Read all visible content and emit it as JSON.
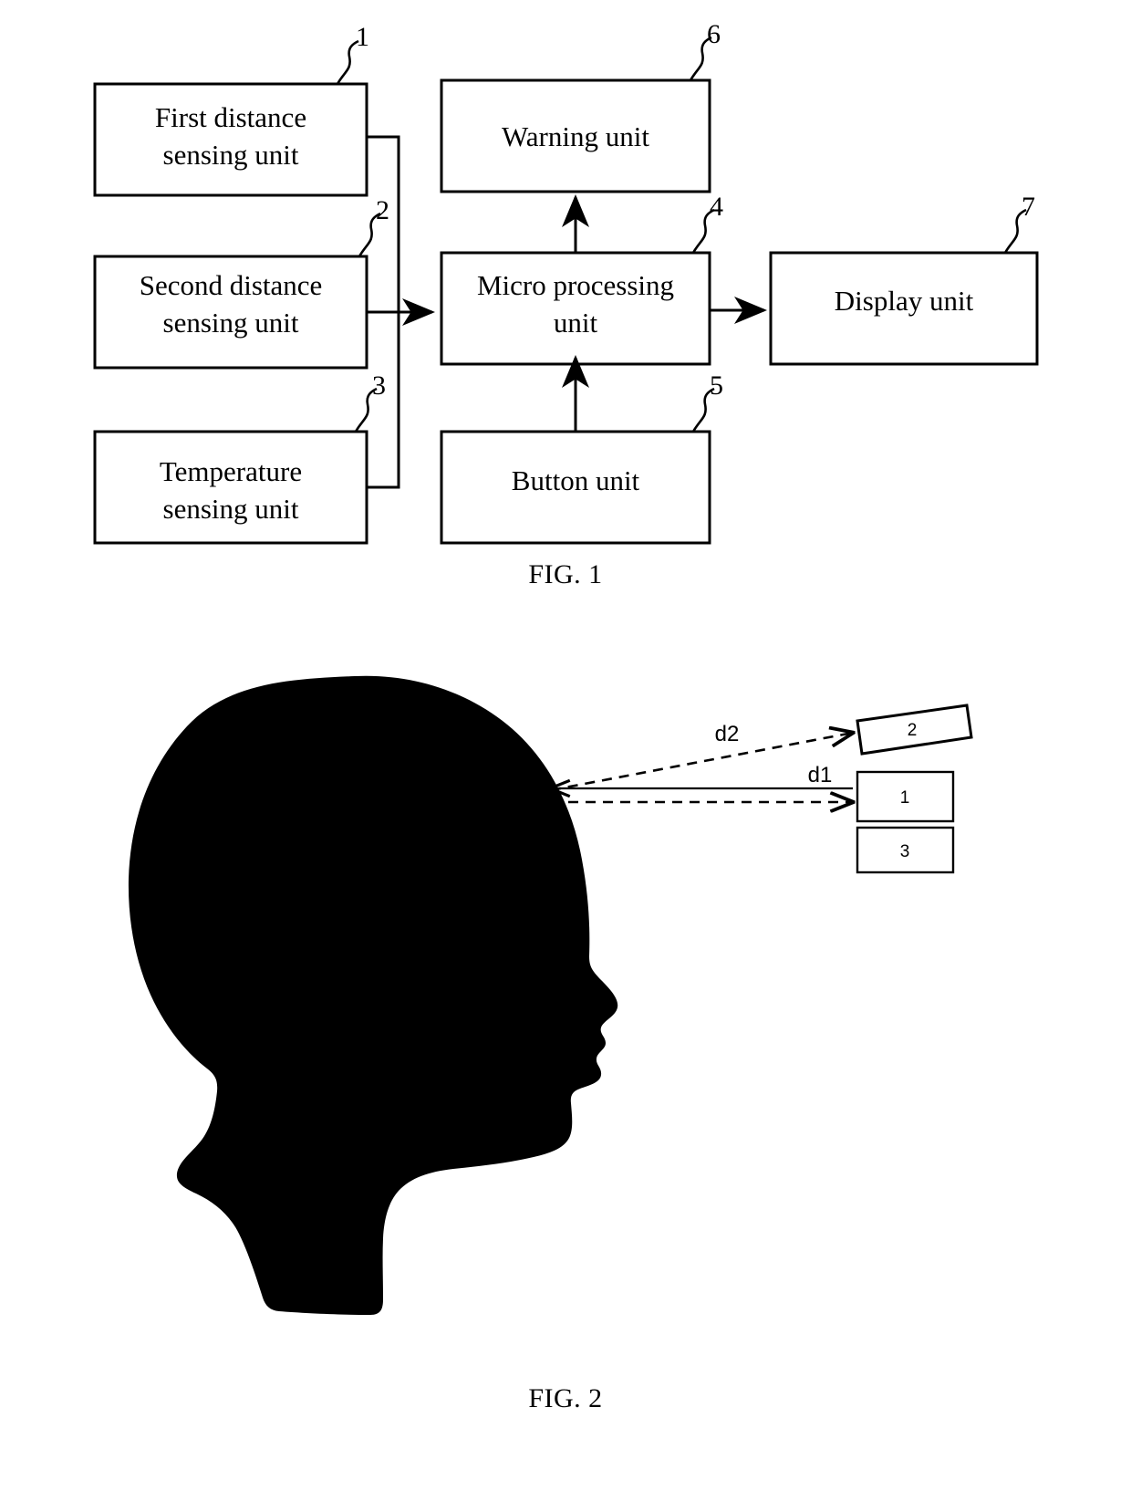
{
  "document": {
    "type": "patent-drawing-sheet",
    "background_color": "#ffffff",
    "line_color": "#000000"
  },
  "figure1": {
    "caption": "FIG. 1",
    "blocks": [
      {
        "id": "first-distance-sensing-unit",
        "line1": "First distance",
        "line2": "sensing unit",
        "ref": "1"
      },
      {
        "id": "second-distance-sensing-unit",
        "line1": "Second distance",
        "line2": "sensing unit",
        "ref": "2"
      },
      {
        "id": "temperature-sensing-unit",
        "line1": "Temperature",
        "line2": "sensing unit",
        "ref": "3"
      },
      {
        "id": "micro-processing-unit",
        "line1": "Micro processing",
        "line2": "unit",
        "ref": "4"
      },
      {
        "id": "button-unit",
        "line1": "Button unit",
        "line2": "",
        "ref": "5"
      },
      {
        "id": "warning-unit",
        "line1": "Warning unit",
        "line2": "",
        "ref": "6"
      },
      {
        "id": "display-unit",
        "line1": "Display unit",
        "line2": "",
        "ref": "7"
      }
    ],
    "connections": [
      {
        "from": "first-distance-sensing-unit",
        "to": "micro-processing-unit",
        "style": "solid-arrow"
      },
      {
        "from": "second-distance-sensing-unit",
        "to": "micro-processing-unit",
        "style": "solid-arrow"
      },
      {
        "from": "temperature-sensing-unit",
        "to": "micro-processing-unit",
        "style": "solid-arrow"
      },
      {
        "from": "button-unit",
        "to": "micro-processing-unit",
        "style": "solid-arrow"
      },
      {
        "from": "micro-processing-unit",
        "to": "warning-unit",
        "style": "solid-arrow"
      },
      {
        "from": "micro-processing-unit",
        "to": "display-unit",
        "style": "solid-arrow"
      }
    ]
  },
  "figure2": {
    "caption": "FIG. 2",
    "subject": "human-head-profile-silhouette",
    "sensors": [
      {
        "id": "sensor-2",
        "label": "2",
        "orientation": "tilted"
      },
      {
        "id": "sensor-1",
        "label": "1",
        "orientation": "upright"
      },
      {
        "id": "sensor-3",
        "label": "3",
        "orientation": "upright"
      }
    ],
    "distance_labels": [
      {
        "id": "d2",
        "text": "d2",
        "style": "dashed"
      },
      {
        "id": "d1",
        "text": "d1",
        "style": "dashed"
      }
    ]
  }
}
